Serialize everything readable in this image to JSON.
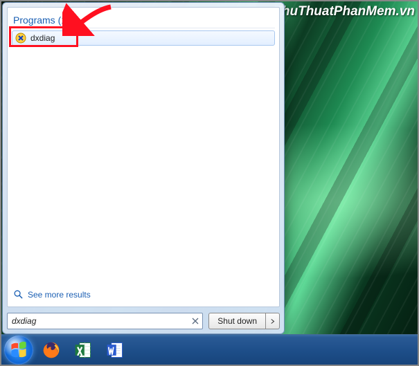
{
  "watermark": "ThuThuatPhanMem.vn",
  "start_menu": {
    "section_header": "Programs (1)",
    "results": [
      {
        "label": "dxdiag",
        "icon": "dxdiag-icon"
      }
    ],
    "see_more_label": "See more results",
    "search_value": "dxdiag",
    "shutdown_label": "Shut down"
  },
  "taskbar": {
    "items": [
      {
        "name": "start",
        "icon": "windows-logo"
      },
      {
        "name": "firefox",
        "icon": "firefox-icon"
      },
      {
        "name": "excel",
        "icon": "excel-icon"
      },
      {
        "name": "word",
        "icon": "word-icon"
      }
    ]
  },
  "annotations": {
    "highlight_target": "result-dxdiag",
    "arrow_points_to": "result-dxdiag"
  }
}
